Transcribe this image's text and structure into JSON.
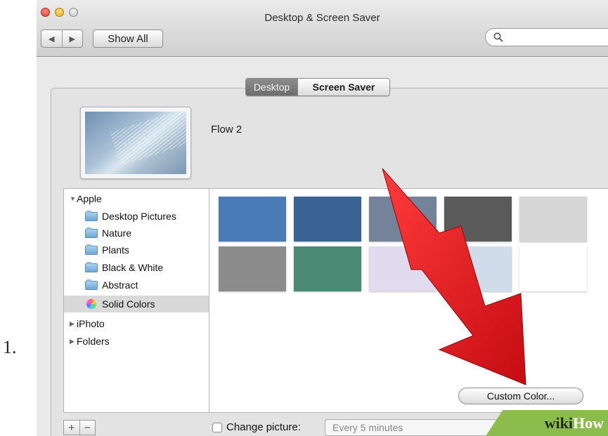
{
  "step_number": "1.",
  "window": {
    "title": "Desktop & Screen Saver",
    "nav_back": "◀",
    "nav_forward": "▶",
    "show_all": "Show All",
    "search_placeholder": ""
  },
  "tabs": [
    {
      "label": "Desktop",
      "active": true
    },
    {
      "label": "Screen Saver",
      "active": false
    }
  ],
  "preview": {
    "name": "Flow 2"
  },
  "sources": [
    {
      "label": "Apple",
      "disclosure": "▼",
      "indent": 0,
      "icon": "none"
    },
    {
      "label": "Desktop Pictures",
      "indent": 1,
      "icon": "folder-icon"
    },
    {
      "label": "Nature",
      "indent": 1,
      "icon": "folder-icon"
    },
    {
      "label": "Plants",
      "indent": 1,
      "icon": "folder-icon"
    },
    {
      "label": "Black & White",
      "indent": 1,
      "icon": "folder-icon"
    },
    {
      "label": "Abstract",
      "indent": 1,
      "icon": "folder-icon"
    },
    {
      "label": "Solid Colors",
      "indent": 1,
      "icon": "color-wheel-icon",
      "selected": true
    },
    {
      "label": "iPhoto",
      "disclosure": "▶",
      "indent": 0,
      "icon": "none"
    },
    {
      "label": "Folders",
      "disclosure": "▶",
      "indent": 0,
      "icon": "none"
    }
  ],
  "swatches": [
    "#4a7bb7",
    "#3a6494",
    "#74839a",
    "#5a5a5a",
    "#d6d6d6",
    "#8c8c8c",
    "#4a8a74",
    "#e0dbee",
    "#d0dce9",
    "#ffffff"
  ],
  "custom_color_button": "Custom Color...",
  "bottom": {
    "add": "+",
    "remove": "−",
    "change_picture_label": "Change picture:",
    "interval": "Every 5 minutes",
    "select_arrows": "⬍"
  },
  "annotation": {
    "arrow_color": "#e8141a"
  },
  "watermark": {
    "wiki": "wiki",
    "how": "How"
  }
}
